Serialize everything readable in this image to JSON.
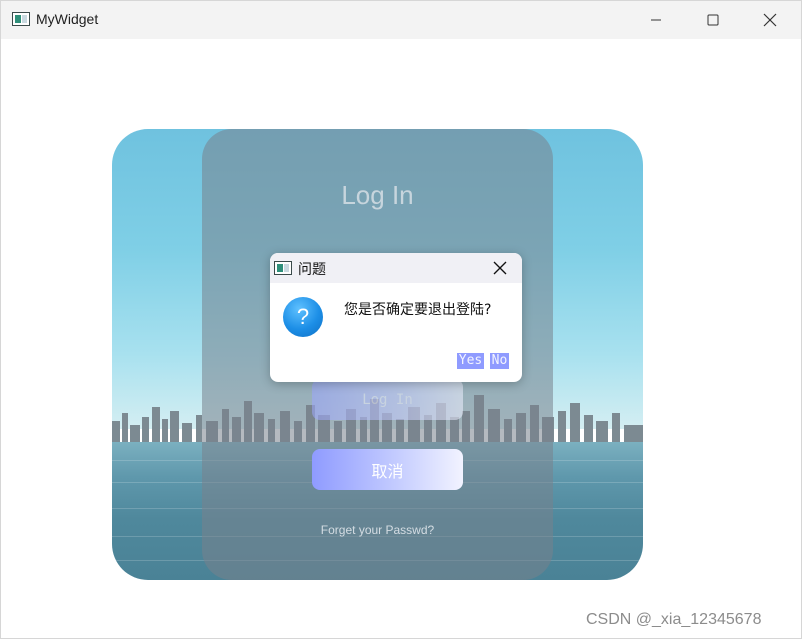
{
  "window": {
    "title": "MyWidget",
    "icon": "app-window-icon",
    "controls": [
      "minimize-icon",
      "maximize-icon",
      "close-icon"
    ]
  },
  "login": {
    "title": "Log In",
    "login_button": "Log In",
    "cancel_button": "取消",
    "forgot_link": "Forget your Passwd?"
  },
  "dialog": {
    "title": "问题",
    "message": "您是否确定要退出登陆?",
    "icon": "question-icon",
    "yes": "Yes",
    "no": "No"
  },
  "watermark": "CSDN @_xia_12345678",
  "colors": {
    "button_accent": "#8f9bff",
    "question_icon": "#1c8ee6"
  }
}
